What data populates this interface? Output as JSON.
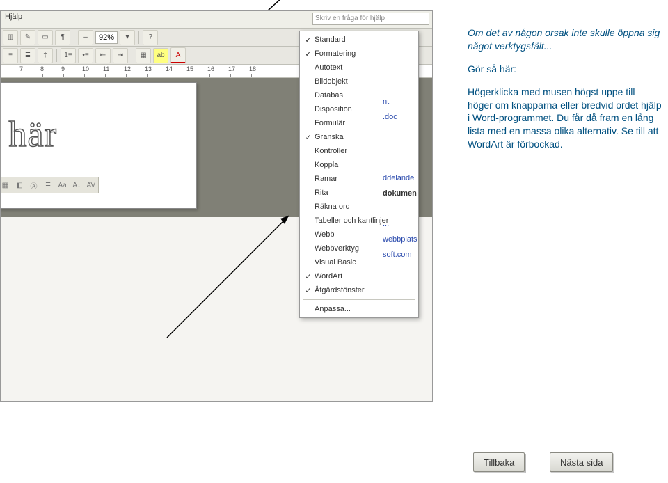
{
  "menu": {
    "help": "Hjälp"
  },
  "helpbox": {
    "placeholder": "Skriv en fråga för hjälp"
  },
  "zoom": "92%",
  "ruler": [
    "7",
    "8",
    "9",
    "10",
    "11",
    "12",
    "13",
    "14",
    "15",
    "16",
    "17",
    "18"
  ],
  "wordart_sample": "ext här",
  "context": {
    "items": [
      {
        "checked": true,
        "label": "Standard"
      },
      {
        "checked": true,
        "label": "Formatering"
      },
      {
        "checked": false,
        "label": "Autotext"
      },
      {
        "checked": false,
        "label": "Bildobjekt"
      },
      {
        "checked": false,
        "label": "Databas"
      },
      {
        "checked": false,
        "label": "Disposition"
      },
      {
        "checked": false,
        "label": "Formulär"
      },
      {
        "checked": true,
        "label": "Granska"
      },
      {
        "checked": false,
        "label": "Kontroller"
      },
      {
        "checked": false,
        "label": "Koppla"
      },
      {
        "checked": false,
        "label": "Ramar"
      },
      {
        "checked": false,
        "label": "Rita"
      },
      {
        "checked": false,
        "label": "Räkna ord"
      },
      {
        "checked": false,
        "label": "Tabeller och kantlinjer"
      },
      {
        "checked": false,
        "label": "Webb"
      },
      {
        "checked": false,
        "label": "Webbverktyg"
      },
      {
        "checked": false,
        "label": "Visual Basic"
      },
      {
        "checked": true,
        "label": "WordArt"
      },
      {
        "checked": true,
        "label": "Åtgärdsfönster"
      }
    ],
    "customize": "Anpassa..."
  },
  "peek": [
    "nt",
    ".doc",
    "",
    "",
    "",
    "ddelande",
    "dokumen",
    "",
    "...",
    "webbplats",
    "soft.com"
  ],
  "explain": {
    "p1": "Om det av någon orsak inte skulle öppna sig något verktygsfält...",
    "p2": "Gör så här:",
    "p3": "Högerklicka med musen högst uppe till höger om knapparna eller bredvid ordet hjälp i Word-programmet. Du får då fram en lång lista med en massa olika alternativ. Se till att WordArt är förbockad."
  },
  "nav": {
    "back": "Tillbaka",
    "next": "Nästa sida"
  }
}
